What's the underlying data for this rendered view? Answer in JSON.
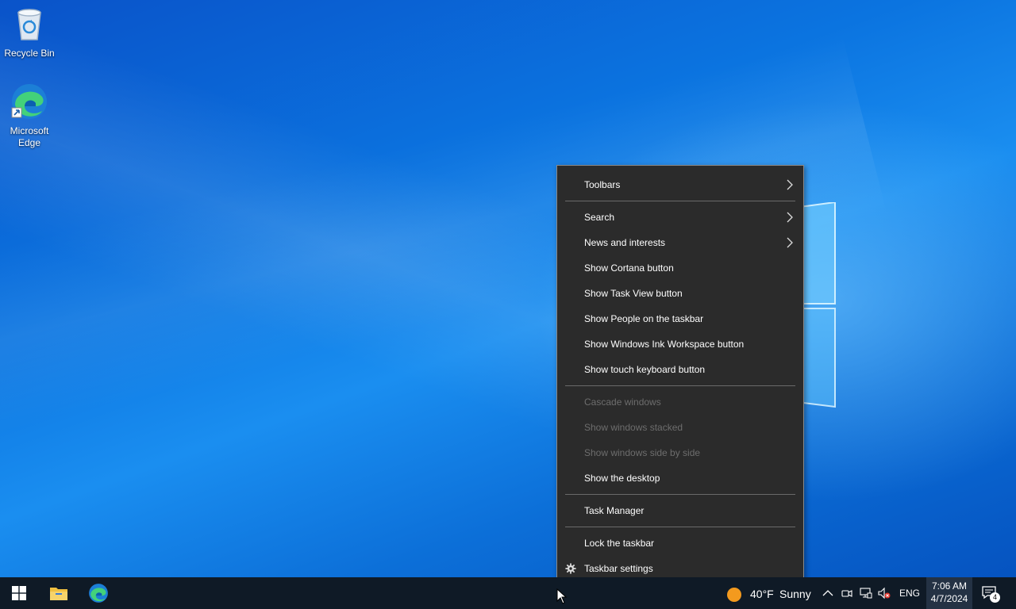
{
  "desktop": {
    "icons": [
      {
        "label": "Recycle Bin"
      },
      {
        "label": "Microsoft Edge"
      }
    ]
  },
  "context_menu": {
    "groups": [
      [
        {
          "label": "Toolbars",
          "submenu": true,
          "enabled": true
        }
      ],
      [
        {
          "label": "Search",
          "submenu": true,
          "enabled": true
        },
        {
          "label": "News and interests",
          "submenu": true,
          "enabled": true
        },
        {
          "label": "Show Cortana button",
          "enabled": true
        },
        {
          "label": "Show Task View button",
          "enabled": true
        },
        {
          "label": "Show People on the taskbar",
          "enabled": true
        },
        {
          "label": "Show Windows Ink Workspace button",
          "enabled": true
        },
        {
          "label": "Show touch keyboard button",
          "enabled": true
        }
      ],
      [
        {
          "label": "Cascade windows",
          "enabled": false
        },
        {
          "label": "Show windows stacked",
          "enabled": false
        },
        {
          "label": "Show windows side by side",
          "enabled": false
        },
        {
          "label": "Show the desktop",
          "enabled": true
        }
      ],
      [
        {
          "label": "Task Manager",
          "enabled": true
        }
      ],
      [
        {
          "label": "Lock the taskbar",
          "enabled": true
        },
        {
          "label": "Taskbar settings",
          "enabled": true,
          "icon": "gear-icon"
        }
      ]
    ]
  },
  "taskbar": {
    "weather": {
      "temp": "40°F",
      "condition": "Sunny"
    },
    "language": "ENG",
    "time": "7:06 AM",
    "date": "4/7/2024",
    "notification_count": "4"
  },
  "colors": {
    "menu_bg": "#2b2b2b",
    "taskbar_bg": "#0f1a26",
    "disabled_text": "#6d6d6d"
  }
}
